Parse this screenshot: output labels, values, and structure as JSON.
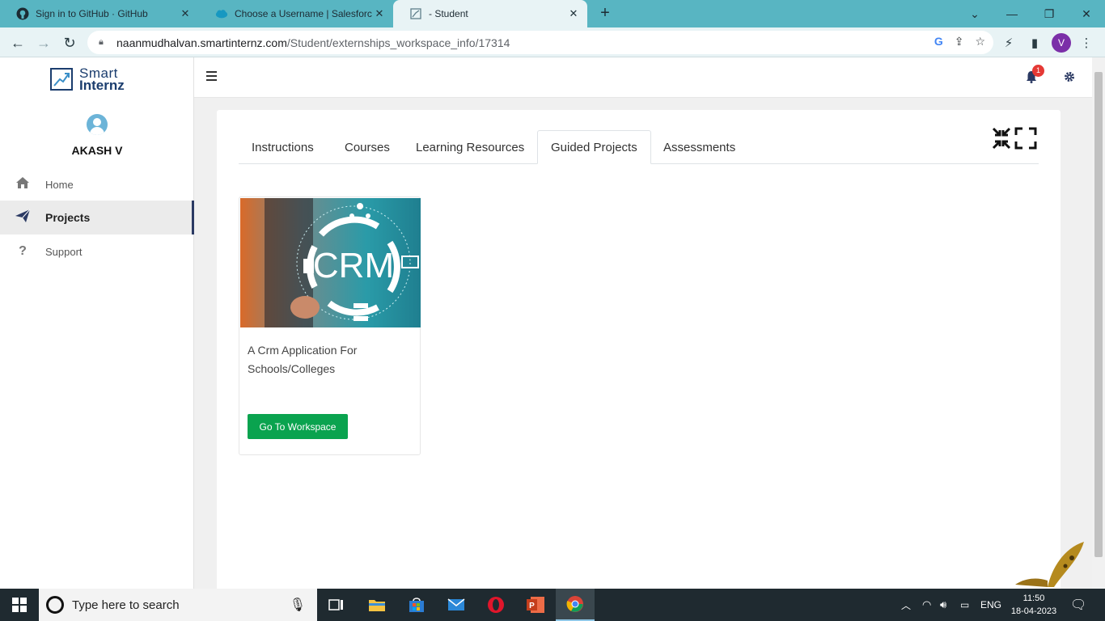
{
  "browser": {
    "tabs": [
      {
        "title": "Sign in to GitHub · GitHub",
        "icon": "github-icon"
      },
      {
        "title": "Choose a Username | Salesforce",
        "icon": "salesforce-cloud-icon"
      },
      {
        "title": "- Student",
        "icon": "page-icon"
      }
    ],
    "url_host": "naanmudhalvan.smartinternz.com",
    "url_path": "/Student/externships_workspace_info/17314",
    "profile_initial": "V"
  },
  "sidebar": {
    "logo_line1": "Smart",
    "logo_line2": "Internz",
    "username": "AKASH V",
    "items": [
      {
        "label": "Home",
        "icon": "home-icon"
      },
      {
        "label": "Projects",
        "icon": "paper-plane-icon",
        "active": true
      },
      {
        "label": "Support",
        "icon": "question-icon"
      }
    ]
  },
  "topbar": {
    "notification_count": "1"
  },
  "content": {
    "tabs": [
      "Instructions",
      "Courses",
      "Learning Resources",
      "Guided Projects",
      "Assessments"
    ],
    "active_tab": "Guided Projects",
    "project": {
      "image_text": "CRM",
      "title": "A Crm Application For Schools/Colleges",
      "button_label": "Go To Workspace"
    }
  },
  "taskbar": {
    "search_placeholder": "Type here to search",
    "language": "ENG",
    "time": "11:50",
    "date": "18-04-2023"
  },
  "colors": {
    "tabstrip": "#58b5c2",
    "accent_green": "#0aa34f",
    "nav_active_border": "#2b3a63"
  }
}
